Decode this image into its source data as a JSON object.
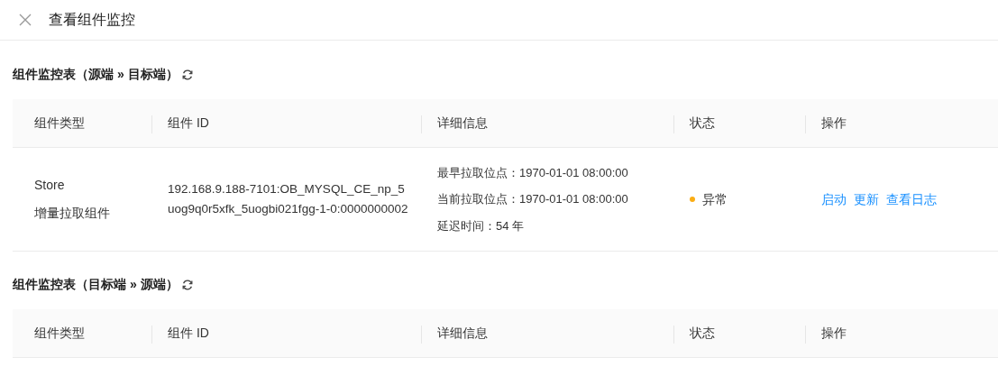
{
  "header": {
    "title": "查看组件监控"
  },
  "sections": [
    {
      "title": "组件监控表（源端 » 目标端）",
      "columns": [
        "组件类型",
        "组件 ID",
        "详细信息",
        "状态",
        "操作"
      ],
      "rows": [
        {
          "type_lines": [
            "Store",
            "增量拉取组件"
          ],
          "id": "192.168.9.188-7101:OB_MYSQL_CE_np_5uog9q0r5xfk_5uogbi021fgg-1-0:0000000002",
          "details": [
            "最早拉取位点：1970-01-01 08:00:00",
            "当前拉取位点：1970-01-01 08:00:00",
            "延迟时间：54 年"
          ],
          "status": {
            "label": "异常",
            "color": "#faad14"
          },
          "actions": [
            "启动",
            "更新",
            "查看日志"
          ]
        }
      ]
    },
    {
      "title": "组件监控表（目标端 » 源端）",
      "columns": [
        "组件类型",
        "组件 ID",
        "详细信息",
        "状态",
        "操作"
      ]
    }
  ]
}
